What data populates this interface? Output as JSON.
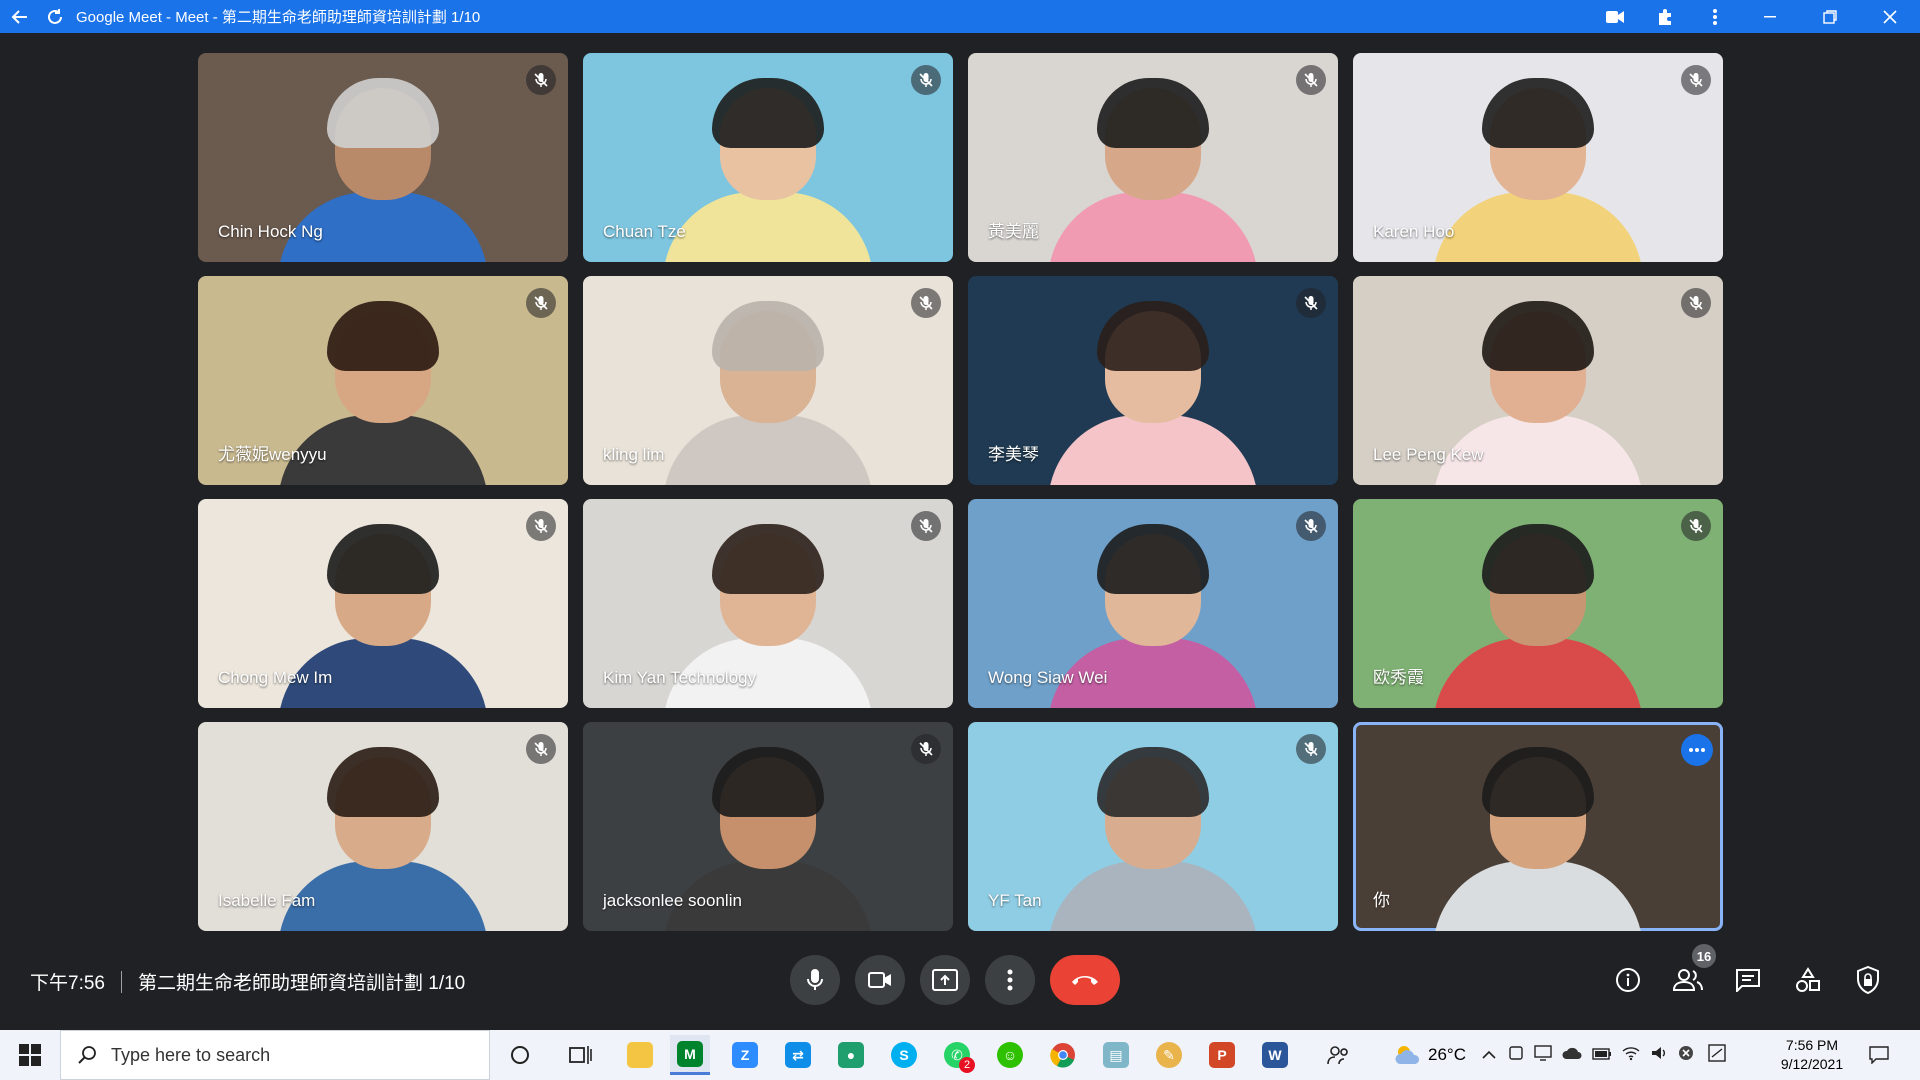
{
  "window": {
    "title": "Google Meet - Meet - 第二期生命老師助理師資培訓計劃 1/10"
  },
  "participants": [
    {
      "name": "Chin Hock Ng",
      "bg": "#6b5a4e",
      "skin": "#b98a6a",
      "hair": "#cfcfcf",
      "shirt": "#2f6fc6"
    },
    {
      "name": "Chuan Tze",
      "bg": "#7ec6e0",
      "skin": "#e9c2a2",
      "hair": "#1c1c1c",
      "shirt": "#efe49a"
    },
    {
      "name": "黃美麗",
      "bg": "#d9d6d2",
      "skin": "#d6a889",
      "hair": "#1c1c1c",
      "shirt": "#f19bb3"
    },
    {
      "name": "Karen Hoo",
      "bg": "#e6e6ea",
      "skin": "#e3b493",
      "hair": "#1c1c1c",
      "shirt": "#f2d27a"
    },
    {
      "name": "尤薇妮wenyyu",
      "bg": "#c9b98f",
      "skin": "#d7a784",
      "hair": "#2b1a12",
      "shirt": "#3a3a3a"
    },
    {
      "name": "kling lim",
      "bg": "#e8e2d8",
      "skin": "#d9b394",
      "hair": "#b9b3ab",
      "shirt": "#cfc8c2"
    },
    {
      "name": "李美琴",
      "bg": "#1f3a52",
      "skin": "#e5bca0",
      "hair": "#2a1f1a",
      "shirt": "#f4c4c9"
    },
    {
      "name": "Lee Peng Kew",
      "bg": "#d5cfc6",
      "skin": "#e1b092",
      "hair": "#1f1814",
      "shirt": "#f7e6e8"
    },
    {
      "name": "Chong Mew Im",
      "bg": "#ece6dc",
      "skin": "#d8a987",
      "hair": "#1b1b1b",
      "shirt": "#2f4a7a"
    },
    {
      "name": "Kim Yan Technology",
      "bg": "#d8d6d2",
      "skin": "#e0b596",
      "hair": "#2c2119",
      "shirt": "#f2f2f2"
    },
    {
      "name": "Wong Siaw Wei",
      "bg": "#6fa0c9",
      "skin": "#e0b798",
      "hair": "#1c1c1c",
      "shirt": "#c45fa3"
    },
    {
      "name": "欧秀霞",
      "bg": "#7fb174",
      "skin": "#c99673",
      "hair": "#1c1c1c",
      "shirt": "#d94b4b"
    },
    {
      "name": "Isabelle Fam",
      "bg": "#e2ded8",
      "skin": "#d8ab8a",
      "hair": "#2a1c14",
      "shirt": "#3a6ea8"
    },
    {
      "name": "jacksonlee soonlin",
      "bg": "#3c4043",
      "skin": "#c5906b",
      "hair": "#1c1c1c",
      "shirt": "#3a3a3a"
    },
    {
      "name": "YF Tan",
      "bg": "#8fcde4",
      "skin": "#d8ad8f",
      "hair": "#2a2a2a",
      "shirt": "#a9b4bf"
    },
    {
      "name": "你",
      "bg": "#4a3f36",
      "skin": "#d5a47f",
      "hair": "#1c1c1c",
      "shirt": "#d9dde0"
    }
  ],
  "bottom_bar": {
    "time": "下午7:56",
    "meeting_title": "第二期生命老師助理師資培訓計劃 1/10",
    "people_count": "16"
  },
  "taskbar": {
    "search_placeholder": "Type here to search",
    "weather": "26°C",
    "clock_time": "7:56 PM",
    "clock_date": "9/12/2021",
    "whatsapp_badge": "2"
  },
  "colors": {
    "accent": "#1a73e8",
    "end_call": "#ea4335",
    "meet_bg": "#202124"
  }
}
